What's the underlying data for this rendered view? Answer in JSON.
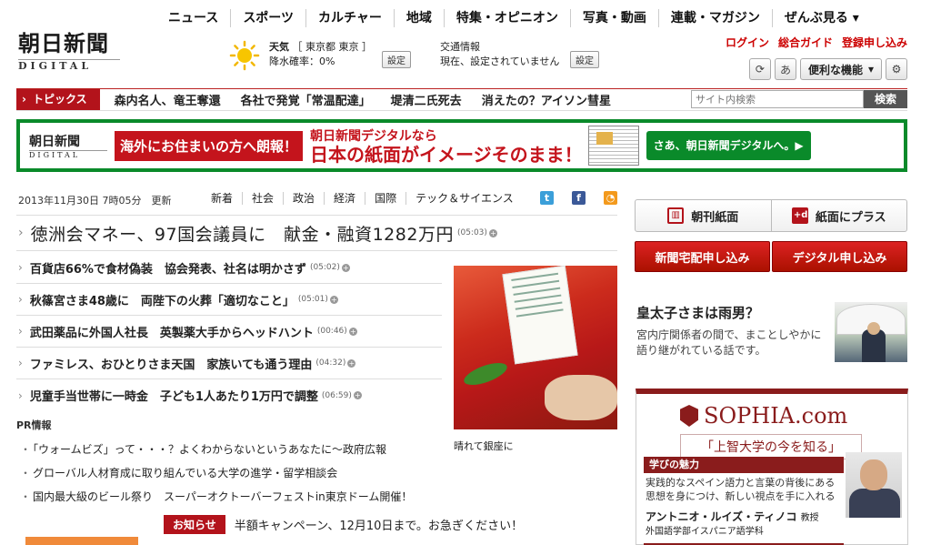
{
  "logo": {
    "jp": "朝日新聞",
    "en": "DIGITAL"
  },
  "topnav": [
    "ニュース",
    "スポーツ",
    "カルチャー",
    "地域",
    "特集・オピニオン",
    "写真・動画",
    "連載・マガジン",
    "ぜんぶ見る ▾"
  ],
  "weather": {
    "title": "天気",
    "location": "［ 東京都 東京 ］",
    "rain": "降水確率：0%",
    "button": "設定",
    "icon": "sun-icon"
  },
  "traffic": {
    "title": "交通情報",
    "status": "現在、設定されていません",
    "button": "設定"
  },
  "userlinks": [
    "ログイン",
    "総合ガイド",
    "登録申し込み"
  ],
  "tools": {
    "refresh_icon": "refresh-icon",
    "kana": "あ",
    "features": "便利な機能",
    "gear_icon": "gear-icon"
  },
  "topics": {
    "label": "トピックス",
    "items": [
      "森内名人、竜王奪還",
      "各社で発覚「常温配達」",
      "堤清二氏死去",
      "消えたの？アイソン彗星"
    ]
  },
  "search": {
    "placeholder": "サイト内検索",
    "button": "検索"
  },
  "banner": {
    "logo_jp": "朝日新聞",
    "logo_en": "DIGITAL",
    "red": "海外にお住まいの方へ朗報！",
    "line1": "朝日新聞デジタルなら",
    "line2": "日本の紙面がイメージそのまま！",
    "cta": "さあ、朝日新聞デジタルへ。▶"
  },
  "dateline": "2013年11月30日 7時05分　更新",
  "categories": [
    "新着",
    "社会",
    "政治",
    "経済",
    "国際",
    "テック＆サイエンス"
  ],
  "lead": {
    "title": "徳洲会マネー、97国会議員に　献金・融資1282万円",
    "time": "(05:03)"
  },
  "news": [
    {
      "title": "百貨店66%で食材偽装　協会発表、社名は明かさず",
      "time": "(05:02)"
    },
    {
      "title": "秋篠宮さま48歳に　両陛下の火葬「適切なこと」",
      "time": "(05:01)"
    },
    {
      "title": "武田薬品に外国人社長　英製薬大手からヘッドハント",
      "time": "(00:46)"
    },
    {
      "title": "ファミレス、おひとりさま天国　家族いても通う理由",
      "time": "(04:32)"
    },
    {
      "title": "児童手当世帯に一時金　子ども1人あたり1万円で調整",
      "time": "(06:59)"
    }
  ],
  "photo_caption": "晴れて銀座に",
  "pr": {
    "label": "PR情報",
    "items": [
      "「ウォームビズ」って・・・？よくわからないというあなたに～政府広報",
      "グローバル人材育成に取り組んでいる大学の進学・留学相談会",
      "国内最大級のビール祭り　スーパーオクトーバーフェストin東京ドーム開催！"
    ]
  },
  "oshirase": {
    "label": "お知らせ",
    "text": "半額キャンペーン、12月10日まで。お急ぎください！"
  },
  "paper_buttons": [
    "朝刊紙面",
    "紙面にプラス"
  ],
  "red_buttons": [
    "新聞宅配申し込み",
    "デジタル申し込み"
  ],
  "feature": {
    "title": "皇太子さまは雨男？",
    "desc": "宮内庁関係者の間で、まことしやかに語り継がれている話です。"
  },
  "ad": {
    "brand": "SOPHIA.com",
    "tag": "「上智大学の今を知る」",
    "strip": "学びの魅力",
    "desc": "実践的なスペイン語力と言葉の背後にある思想を身につけ、新しい視点を手に入れる",
    "prof": "アントニオ・ルイズ・ティノコ",
    "role": "教授",
    "dept": "外国語学部イスパニア語学科"
  }
}
